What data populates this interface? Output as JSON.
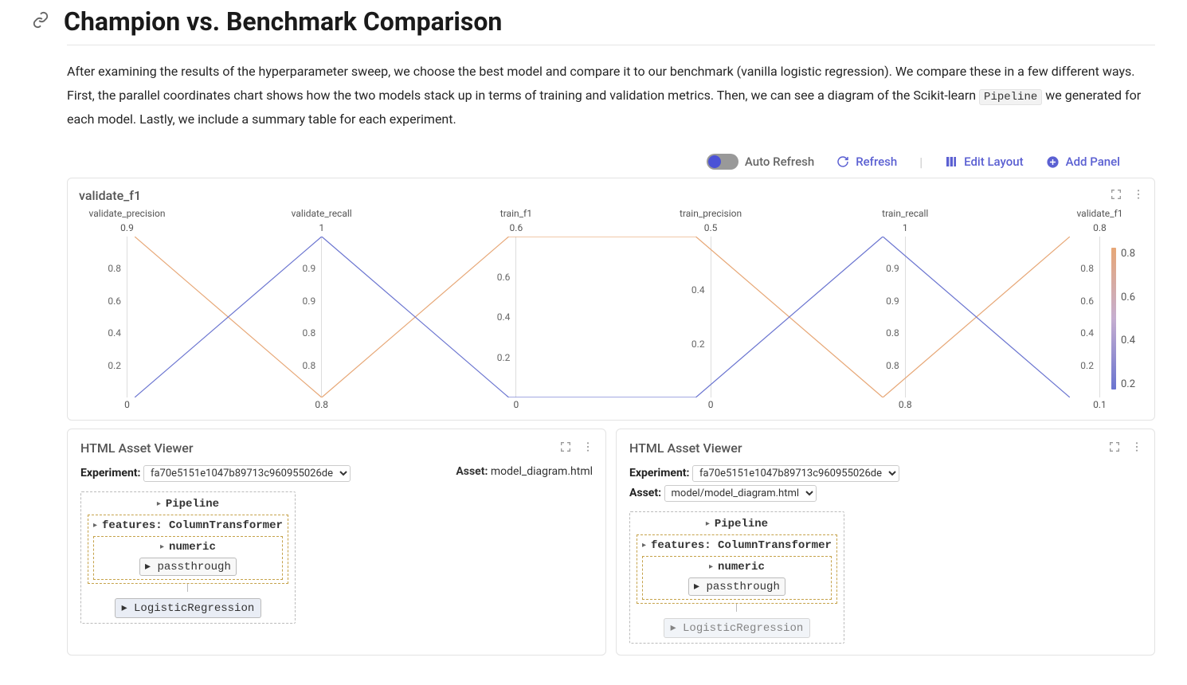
{
  "header": {
    "title": "Champion vs. Benchmark Comparison"
  },
  "intro": {
    "p1a": "After examining the results of the hyperparameter sweep, we choose the best model and compare it to our benchmark (vanilla logistic regression). We compare these in a few different ways. First, the parallel coordinates chart shows how the two models stack up in terms of training and validation metrics. Then, we can see a diagram of the Scikit-learn ",
    "code": "Pipeline",
    "p1b": " we generated for each model. Lastly, we include a summary table for each experiment."
  },
  "toolbar": {
    "auto_refresh": "Auto Refresh",
    "refresh": "Refresh",
    "edit_layout": "Edit Layout",
    "add_panel": "Add Panel"
  },
  "panel1": {
    "title": "validate_f1"
  },
  "chart_data": {
    "type": "parallel-coordinates",
    "color_key": "validate_f1",
    "axes": [
      {
        "name": "validate_precision",
        "top": 0.9,
        "bottom": 0.0,
        "ticks": [
          0.8,
          0.6,
          0.4,
          0.2
        ]
      },
      {
        "name": "validate_recall",
        "top": 1.0,
        "bottom": 0.8,
        "ticks": [
          0.9,
          0.9,
          0.8,
          0.8
        ]
      },
      {
        "name": "train_f1",
        "top": 0.6,
        "bottom": 0.0,
        "ticks": [
          0.6,
          0.4,
          0.2
        ]
      },
      {
        "name": "train_precision",
        "top": 0.5,
        "bottom": 0.0,
        "ticks": [
          0.4,
          0.2
        ]
      },
      {
        "name": "train_recall",
        "top": 1.0,
        "bottom": 0.8,
        "ticks": [
          0.9,
          0.9,
          0.8,
          0.8
        ]
      },
      {
        "name": "validate_f1",
        "top": 0.8,
        "bottom": 0.1,
        "ticks": [
          0.8,
          0.6,
          0.4,
          0.2
        ]
      }
    ],
    "color_scale": {
      "min": 0.1,
      "max": 0.8,
      "ticks": [
        0.8,
        0.6,
        0.4,
        0.2
      ]
    },
    "series": [
      {
        "color": "#e7a776",
        "values": {
          "validate_precision": 0.9,
          "validate_recall": 0.8,
          "train_f1": 0.6,
          "train_precision": 0.5,
          "train_recall": 0.8,
          "validate_f1": 0.8
        }
      },
      {
        "color": "#6a74d0",
        "values": {
          "validate_precision": 0.0,
          "validate_recall": 1.0,
          "train_f1": 0.0,
          "train_precision": 0.0,
          "train_recall": 1.0,
          "validate_f1": 0.1
        }
      }
    ]
  },
  "panels": {
    "left": {
      "title": "HTML Asset Viewer",
      "experiment_label": "Experiment:",
      "experiment_value": "fa70e5151e1047b89713c960955026de",
      "asset_label": "Asset:",
      "asset_value": "model_diagram.html",
      "pipeline": {
        "title": "Pipeline",
        "features_label": "features: ColumnTransformer",
        "numeric": "numeric",
        "passthrough": "passthrough",
        "estimator": "LogisticRegression"
      }
    },
    "right": {
      "title": "HTML Asset Viewer",
      "experiment_label": "Experiment:",
      "experiment_value": "fa70e5151e1047b89713c960955026de",
      "asset_label": "Asset:",
      "asset_value": "model/model_diagram.html",
      "pipeline": {
        "title": "Pipeline",
        "features_label": "features: ColumnTransformer",
        "numeric": "numeric",
        "passthrough": "passthrough",
        "estimator": "LogisticRegression"
      }
    }
  }
}
